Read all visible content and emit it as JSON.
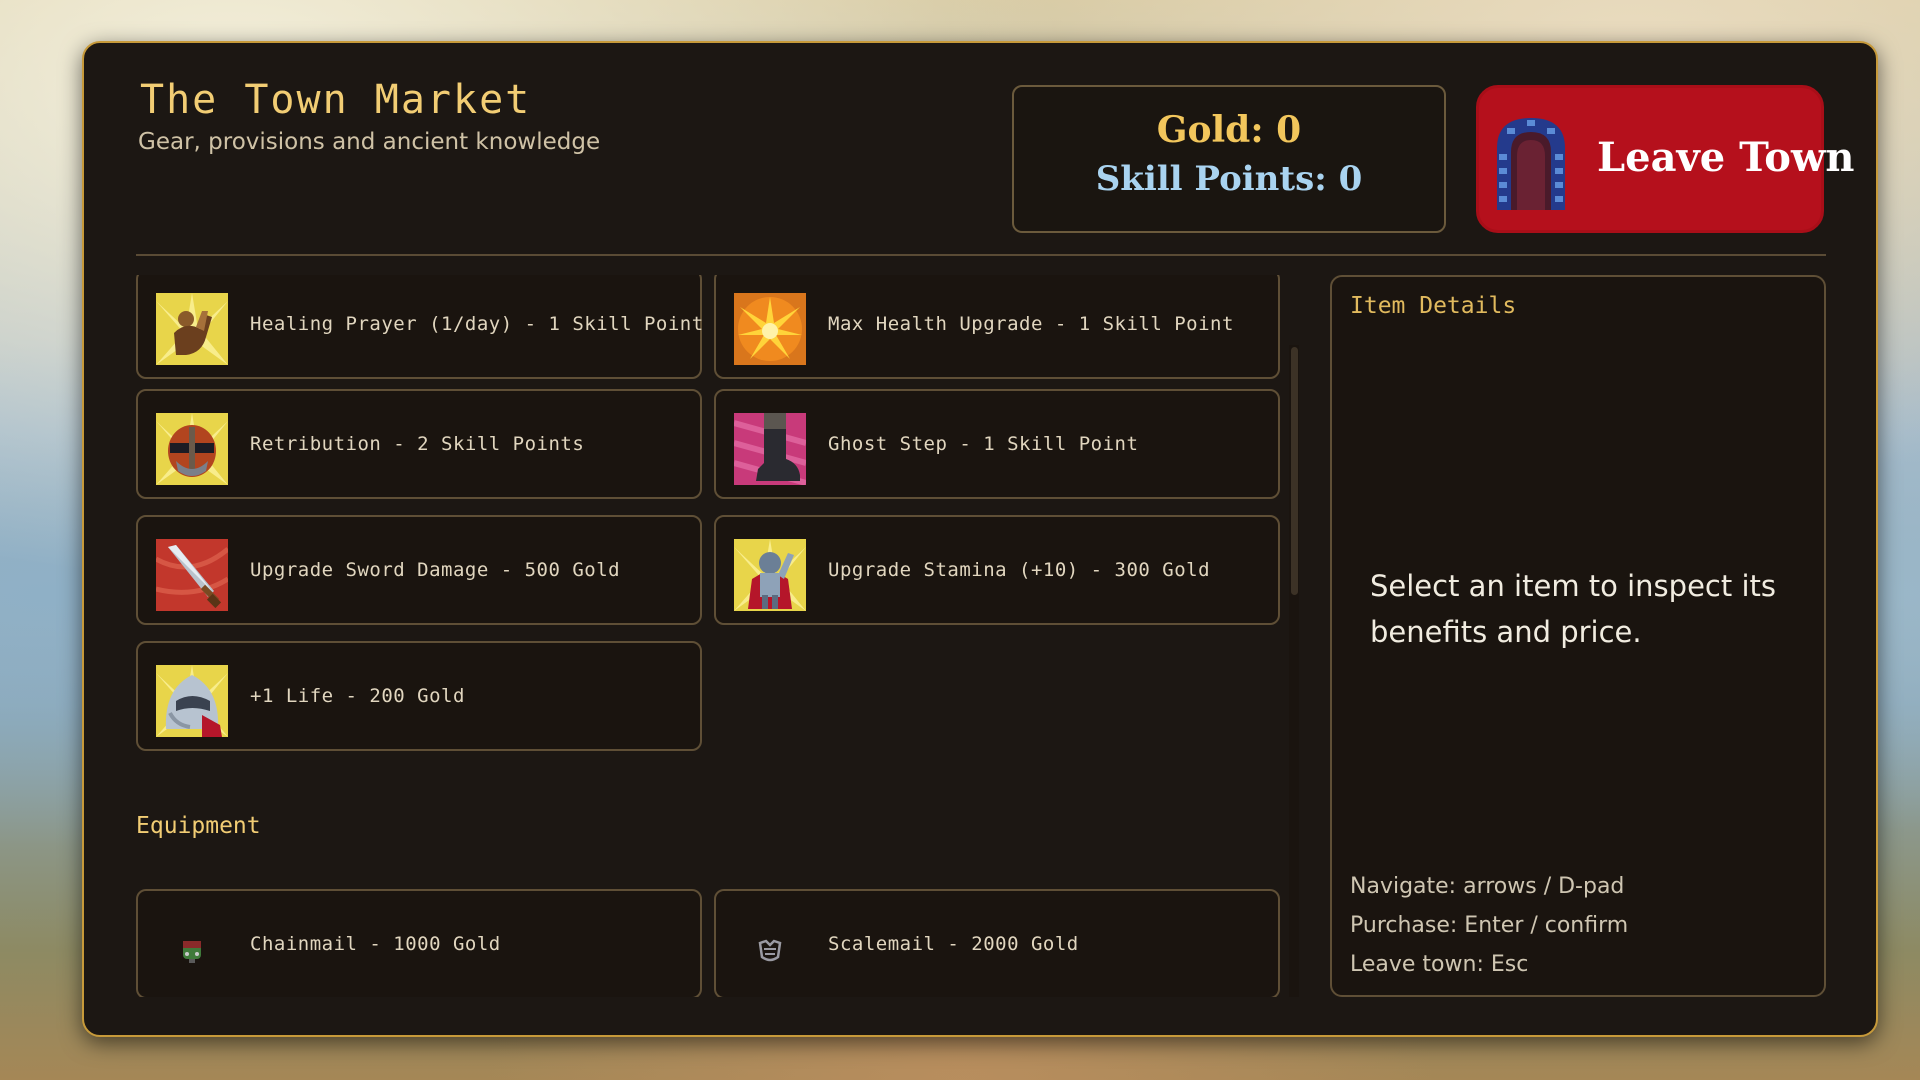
{
  "header": {
    "title": "The Town Market",
    "subtitle": "Gear, provisions and ancient knowledge"
  },
  "currency": {
    "gold_label": "Gold: 0",
    "skill_points_label": "Skill Points: 0"
  },
  "leave_button": {
    "label": "Leave Town",
    "icon": "door-icon"
  },
  "skills": [
    {
      "label": "Healing Prayer (1/day) - 1 Skill Point",
      "icon": "praying-figure-icon"
    },
    {
      "label": "Max Health Upgrade - 1 Skill Point",
      "icon": "sunburst-icon"
    },
    {
      "label": "Retribution - 2 Skill Points",
      "icon": "helmet-icon"
    },
    {
      "label": "Ghost Step - 1 Skill Point",
      "icon": "boot-icon"
    },
    {
      "label": "Upgrade Sword Damage - 500 Gold",
      "icon": "sword-icon"
    },
    {
      "label": "Upgrade Stamina (+10) - 300 Gold",
      "icon": "knight-icon"
    },
    {
      "label": "+1 Life - 200 Gold",
      "icon": "knight-helm-icon"
    }
  ],
  "equipment_section": {
    "title": "Equipment",
    "items": [
      {
        "label": "Chainmail - 1000 Gold",
        "icon": "chainmail-icon"
      },
      {
        "label": "Scalemail - 2000 Gold",
        "icon": "scalemail-icon"
      }
    ]
  },
  "details": {
    "heading": "Item Details",
    "prompt": "Select an item to inspect its benefits and price.",
    "help": [
      "Navigate: arrows / D-pad",
      "Purchase: Enter / confirm",
      "Leave town: Esc"
    ]
  },
  "colors": {
    "panel": "#1c1713",
    "panel_border": "#c79a3a",
    "gold_text": "#f2c65c",
    "skill_text": "#a9d3f0",
    "leave_button": "#b5101c",
    "heading_text": "#f2cd74"
  }
}
